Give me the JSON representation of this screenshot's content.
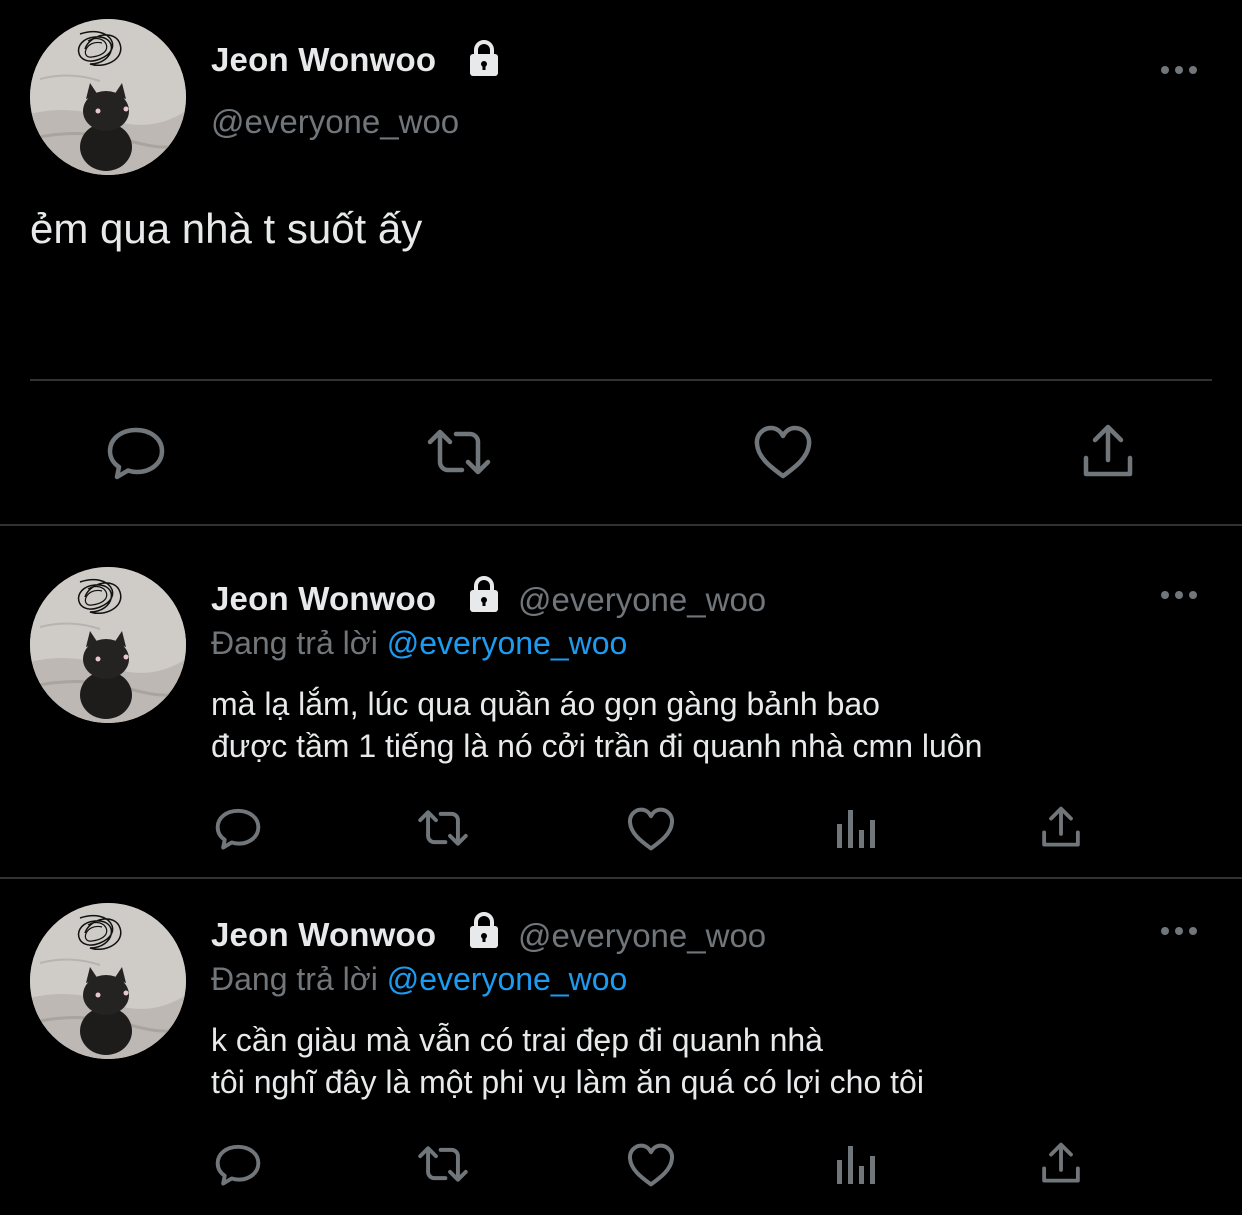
{
  "colors": {
    "background": "#000000",
    "text": "#e7e9ea",
    "secondary": "#71767b",
    "accent": "#1d9bf0",
    "divider": "#2f3336"
  },
  "main_tweet": {
    "author_name": "Jeon Wonwoo",
    "handle": "@everyone_woo",
    "lock_icon": "lock-icon",
    "text": "ẻm qua nhà t suốt ấy",
    "actions": [
      "reply-icon",
      "retweet-icon",
      "like-icon",
      "share-icon"
    ]
  },
  "replies": [
    {
      "author_name": "Jeon Wonwoo",
      "handle": "@everyone_woo",
      "replying_prefix": "Đang trả lời",
      "replying_to": "@everyone_woo",
      "lines": [
        "mà lạ lắm, lúc qua quần áo gọn gàng bảnh bao",
        "được tầm 1 tiếng là nó cởi trần đi quanh nhà cmn luôn"
      ],
      "actions": [
        "reply-icon",
        "retweet-icon",
        "like-icon",
        "analytics-icon",
        "share-icon"
      ]
    },
    {
      "author_name": "Jeon Wonwoo",
      "handle": "@everyone_woo",
      "replying_prefix": "Đang trả lời",
      "replying_to": "@everyone_woo",
      "lines": [
        "k cần giàu mà vẫn có trai đẹp đi quanh nhà",
        "tôi nghĩ đây là một phi vụ làm ăn quá có lợi cho tôi"
      ],
      "actions": [
        "reply-icon",
        "retweet-icon",
        "like-icon",
        "analytics-icon",
        "share-icon"
      ]
    }
  ]
}
